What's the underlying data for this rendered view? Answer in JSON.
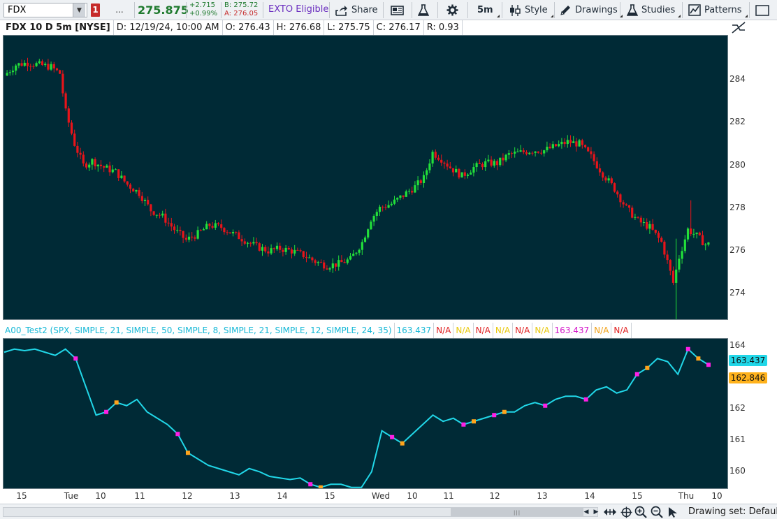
{
  "toolbar": {
    "symbol": "FDX",
    "alert_badge": "1",
    "more_label": "...",
    "last_price": "275.875",
    "change": "+2.715",
    "change_pct": "+0.99%",
    "bid": "B: 275.72",
    "ask": "A: 276.05",
    "exto": "EXTO Eligible",
    "share_label": "Share",
    "timeframe_label": "5m",
    "style_label": "Style",
    "drawings_label": "Drawings",
    "studies_label": "Studies",
    "patterns_label": "Patterns"
  },
  "header": {
    "title": "FDX 10 D 5m [NYSE]",
    "date": "D: 12/19/24, 10:00 AM",
    "open": "O: 276.43",
    "high": "H: 276.68",
    "low": "L: 275.75",
    "close": "C: 276.17",
    "range": "R: 0.93"
  },
  "colors": {
    "background": "#002a36",
    "up": "#22e03a",
    "down": "#e8141a",
    "study_line": "#21d7e8",
    "marker_magenta": "#ff1fe5",
    "marker_orange": "#ffa41b"
  },
  "price_axis": [
    "284",
    "282",
    "280",
    "278",
    "276",
    "274"
  ],
  "study": {
    "name": "A00_Test2 (SPX, SIMPLE, 21, SIMPLE, 50, SIMPLE, 8, SIMPLE, 21, SIMPLE, 12, SIMPLE, 24, 35)",
    "cells": [
      {
        "text": "163.437",
        "color": "#16b8d6"
      },
      {
        "text": "N/A",
        "color": "#e01e1e"
      },
      {
        "text": "N/A",
        "color": "#e8c80a"
      },
      {
        "text": "N/A",
        "color": "#e01e1e"
      },
      {
        "text": "N/A",
        "color": "#e8c80a"
      },
      {
        "text": "N/A",
        "color": "#e01e1e"
      },
      {
        "text": "N/A",
        "color": "#e8c80a"
      },
      {
        "text": "163.437",
        "color": "#d417c9"
      },
      {
        "text": "N/A",
        "color": "#f0a015"
      },
      {
        "text": "N/A",
        "color": "#e01e1e"
      }
    ],
    "axis": [
      "164",
      "163",
      "162",
      "161",
      "160"
    ],
    "last_tag": "163.437",
    "second_tag": "162.846"
  },
  "time_axis": [
    "15",
    "Tue",
    "10",
    "11",
    "12",
    "13",
    "14",
    "15",
    "Wed",
    "10",
    "11",
    "12",
    "13",
    "14",
    "15",
    "Thu",
    "10"
  ],
  "bottom": {
    "drawing_set": "Drawing set: Default"
  },
  "chart_data": [
    {
      "type": "candlestick",
      "title": "FDX 10 D 5m [NYSE]",
      "ylim": [
        272.8,
        286.1
      ],
      "x_labels": [
        "15",
        "Tue",
        "10",
        "11",
        "12",
        "13",
        "14",
        "15",
        "Wed",
        "10",
        "11",
        "12",
        "13",
        "14",
        "15",
        "Thu",
        "10"
      ],
      "close_path": [
        [
          0,
          284.2
        ],
        [
          4,
          284.7
        ],
        [
          8,
          284.8
        ],
        [
          12,
          284.7
        ],
        [
          16,
          284.6
        ],
        [
          19,
          284.3
        ],
        [
          21,
          282.5
        ],
        [
          24,
          281.0
        ],
        [
          27,
          280.0
        ],
        [
          30,
          280.2
        ],
        [
          34,
          279.9
        ],
        [
          38,
          279.7
        ],
        [
          42,
          279.1
        ],
        [
          46,
          278.7
        ],
        [
          50,
          277.9
        ],
        [
          54,
          277.6
        ],
        [
          58,
          277.0
        ],
        [
          62,
          276.5
        ],
        [
          66,
          276.8
        ],
        [
          70,
          277.2
        ],
        [
          74,
          277.1
        ],
        [
          78,
          276.8
        ],
        [
          82,
          276.5
        ],
        [
          86,
          276.2
        ],
        [
          90,
          276.0
        ],
        [
          94,
          276.1
        ],
        [
          98,
          276.0
        ],
        [
          102,
          275.8
        ],
        [
          106,
          275.5
        ],
        [
          110,
          275.3
        ],
        [
          114,
          275.4
        ],
        [
          118,
          275.6
        ],
        [
          122,
          276.4
        ],
        [
          125,
          277.5
        ],
        [
          128,
          278.0
        ],
        [
          132,
          278.2
        ],
        [
          136,
          278.6
        ],
        [
          140,
          279.0
        ],
        [
          143,
          279.4
        ],
        [
          146,
          280.6
        ],
        [
          149,
          280.3
        ],
        [
          152,
          279.9
        ],
        [
          156,
          279.5
        ],
        [
          160,
          279.9
        ],
        [
          164,
          280.1
        ],
        [
          168,
          280.1
        ],
        [
          172,
          280.5
        ],
        [
          176,
          280.6
        ],
        [
          180,
          280.7
        ],
        [
          184,
          280.7
        ],
        [
          188,
          280.9
        ],
        [
          192,
          281.1
        ],
        [
          196,
          281.0
        ],
        [
          200,
          280.4
        ],
        [
          204,
          279.6
        ],
        [
          208,
          278.9
        ],
        [
          212,
          278.0
        ],
        [
          216,
          277.4
        ],
        [
          220,
          277.1
        ],
        [
          224,
          276.4
        ],
        [
          226,
          275.5
        ],
        [
          228,
          274.5
        ],
        [
          230,
          275.7
        ],
        [
          233,
          277.0
        ],
        [
          236,
          276.7
        ],
        [
          239,
          276.3
        ]
      ]
    },
    {
      "type": "line",
      "series": [
        {
          "name": "A00_Test2",
          "values": [
            163.8,
            163.9,
            163.85,
            163.9,
            163.8,
            163.7,
            163.9,
            163.6,
            162.7,
            161.8,
            161.9,
            162.2,
            162.1,
            162.3,
            161.9,
            161.7,
            161.5,
            161.2,
            160.6,
            160.4,
            160.2,
            160.1,
            160.0,
            159.9,
            160.1,
            160.0,
            159.85,
            159.8,
            159.75,
            159.8,
            159.6,
            159.5,
            159.6,
            159.6,
            159.5,
            159.5,
            160.0,
            161.3,
            161.1,
            160.9,
            161.2,
            161.5,
            161.8,
            161.6,
            161.7,
            161.5,
            161.6,
            161.7,
            161.8,
            161.9,
            161.9,
            162.1,
            162.2,
            162.1,
            162.3,
            162.4,
            162.4,
            162.3,
            162.6,
            162.7,
            162.5,
            162.6,
            163.1,
            163.3,
            163.6,
            163.5,
            163.1,
            163.9,
            163.6,
            163.4
          ]
        }
      ],
      "ylim": [
        159.45,
        164.25
      ]
    }
  ]
}
